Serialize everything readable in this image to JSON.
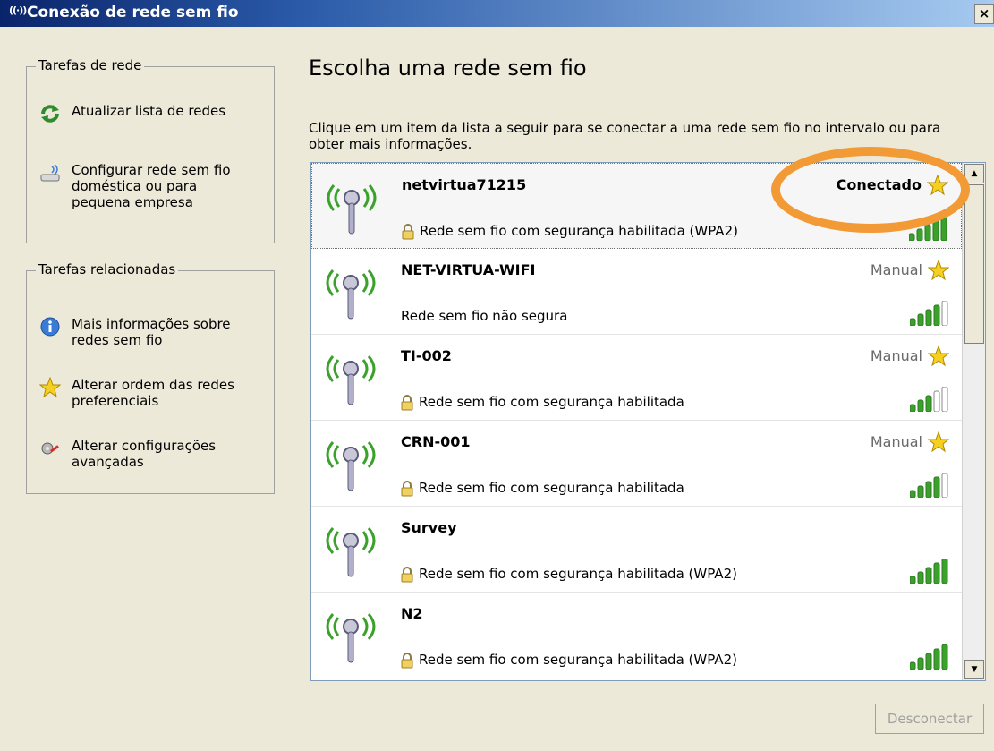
{
  "window": {
    "title": "Conexão de rede sem fio",
    "close_label": "×"
  },
  "sidebar": {
    "network_tasks": {
      "title": "Tarefas de rede",
      "items": [
        {
          "label": "Atualizar lista de redes",
          "icon": "refresh-icon"
        },
        {
          "label": "Configurar rede sem fio doméstica ou para pequena empresa",
          "icon": "wireless-setup-icon"
        }
      ]
    },
    "related_tasks": {
      "title": "Tarefas relacionadas",
      "items": [
        {
          "label": "Mais informações sobre redes sem fio",
          "icon": "info-icon"
        },
        {
          "label": "Alterar ordem das redes preferenciais",
          "icon": "star-icon"
        },
        {
          "label": "Alterar configurações avançadas",
          "icon": "settings-icon"
        }
      ]
    }
  },
  "main": {
    "heading": "Escolha uma rede sem fio",
    "instructions": "Clique em um item da lista a seguir para se conectar a uma rede sem fio no intervalo ou para obter mais informações.",
    "networks": [
      {
        "name": "netvirtua71215",
        "status": "Conectado",
        "description": "Rede sem fio com segurança habilitada (WPA2)",
        "secured": true,
        "signal": 5,
        "selected": true
      },
      {
        "name": "NET-VIRTUA-WIFI",
        "status": "Manual",
        "description": "Rede sem fio não segura",
        "secured": false,
        "signal": 4
      },
      {
        "name": "TI-002",
        "status": "Manual",
        "description": "Rede sem fio com segurança habilitada",
        "secured": true,
        "signal": 3
      },
      {
        "name": "CRN-001",
        "status": "Manual",
        "description": "Rede sem fio com segurança habilitada",
        "secured": true,
        "signal": 4
      },
      {
        "name": "Survey",
        "status": "",
        "description": "Rede sem fio com segurança habilitada (WPA2)",
        "secured": true,
        "signal": 5
      },
      {
        "name": "N2",
        "status": "",
        "description": "Rede sem fio com segurança habilitada (WPA2)",
        "secured": true,
        "signal": 5
      }
    ],
    "disconnect_label": "Desconectar"
  },
  "colors": {
    "title_bar": "#0a246a",
    "signal_green": "#3aa12a",
    "highlight_orange": "#f29a36",
    "star_gold": "#f5d020"
  }
}
